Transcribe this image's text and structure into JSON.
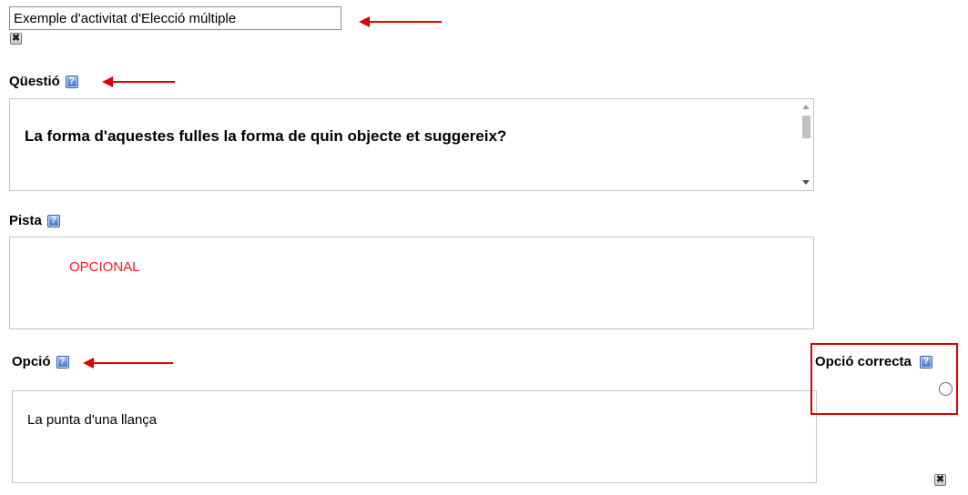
{
  "activity": {
    "title_value": "Exemple d'activitat d'Elecció múltiple",
    "delete_label": "✖"
  },
  "question": {
    "label": "Qüestió",
    "help_label": "?",
    "text": "La forma d'aquestes fulles la forma de quin objecte et suggereix?"
  },
  "hint": {
    "label": "Pista",
    "help_label": "?",
    "text": "OPCIONAL"
  },
  "option": {
    "label": "Opció",
    "help_label": "?",
    "text": "La punta d'una llança",
    "correct_label": "Opció correcta",
    "correct_help_label": "?",
    "delete_label": "✖",
    "is_correct": false
  },
  "annotation_color": "#e00000"
}
